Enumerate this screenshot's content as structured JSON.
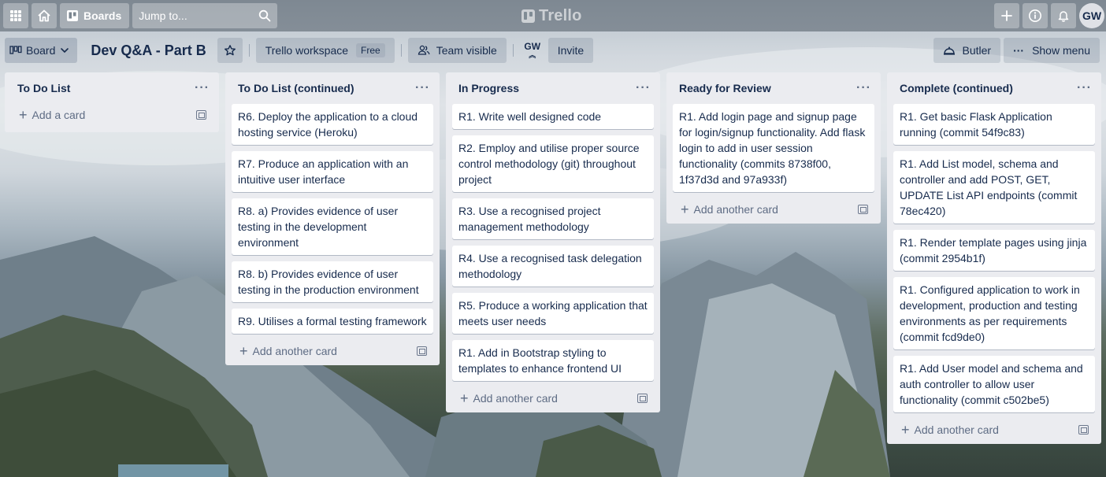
{
  "app": {
    "logo": "Trello",
    "boards_label": "Boards",
    "search_placeholder": "Jump to...",
    "avatar_initials": "GW"
  },
  "board": {
    "view_label": "Board",
    "title": "Dev Q&A - Part B",
    "workspace_label": "Trello workspace",
    "workspace_badge": "Free",
    "visibility_label": "Team visible",
    "member_initials": "GW",
    "invite_label": "Invite",
    "butler_label": "Butler",
    "show_menu_label": "Show menu"
  },
  "lists": [
    {
      "title": "To Do List",
      "cards": [],
      "add_label": "Add a card"
    },
    {
      "title": "To Do List (continued)",
      "cards": [
        "R6. Deploy the application to a cloud hosting service (Heroku)",
        "R7. Produce an application with an intuitive user interface",
        "R8. a) Provides evidence of user testing in the development environment",
        "R8. b) Provides evidence of user testing in the production environment",
        "R9. Utilises a formal testing framework"
      ],
      "add_label": "Add another card"
    },
    {
      "title": "In Progress",
      "cards": [
        "R1. Write well designed code",
        "R2. Employ and utilise proper source control methodology (git) throughout project",
        "R3. Use a recognised project management methodology",
        "R4. Use a recognised task delegation methodology",
        "R5. Produce a working application that meets user needs",
        "R1. Add in Bootstrap styling to templates to enhance frontend UI"
      ],
      "add_label": "Add another card"
    },
    {
      "title": "Ready for Review",
      "cards": [
        "R1. Add login page and signup page for login/signup functionality. Add flask login to add in user session functionality (commits 8738f00, 1f37d3d and 97a933f)"
      ],
      "add_label": "Add another card"
    },
    {
      "title": "Complete (continued)",
      "cards": [
        "R1. Get basic Flask Application running (commit 54f9c83)",
        "R1. Add List model, schema and controller and add POST, GET, UPDATE List API endpoints (commit 78ec420)",
        "R1. Render template pages using jinja (commit 2954b1f)",
        "R1. Configured application to work in development, production and testing environments as per requirements (commit fcd9de0)",
        "R1. Add User model and schema and auth controller to allow user functionality (commit c502be5)"
      ],
      "add_label": "Add another card"
    }
  ]
}
